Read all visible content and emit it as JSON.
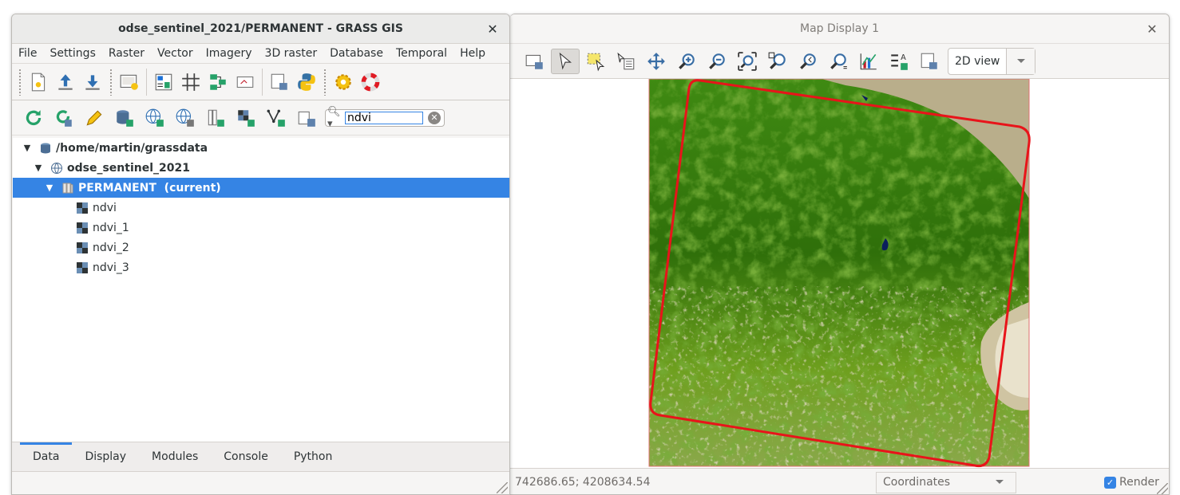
{
  "grass_window": {
    "title": "odse_sentinel_2021/PERMANENT - GRASS GIS",
    "menu": [
      "File",
      "Settings",
      "Raster",
      "Vector",
      "Imagery",
      "3D raster",
      "Database",
      "Temporal",
      "Help"
    ],
    "search": {
      "value": "ndvi"
    },
    "tree": {
      "database": "/home/martin/grassdata",
      "location": "odse_sentinel_2021",
      "mapset": "PERMANENT  (current)",
      "layers": [
        "ndvi",
        "ndvi_1",
        "ndvi_2",
        "ndvi_3"
      ]
    },
    "tabs": [
      "Data",
      "Display",
      "Modules",
      "Console",
      "Python"
    ],
    "active_tab": "Data"
  },
  "map_window": {
    "title": "Map Display 1",
    "view_mode": "2D view",
    "coordinates_text": "742686.65; 4208634.54",
    "coord_mode": "Coordinates",
    "render_label": "Render",
    "render_checked": true
  },
  "colors": {
    "accent": "#3584e4",
    "footprint": "#e8141a",
    "vegetation_dark": "#2f6b0a",
    "vegetation_light": "#8ab32a",
    "soil": "#b9ae8b"
  }
}
